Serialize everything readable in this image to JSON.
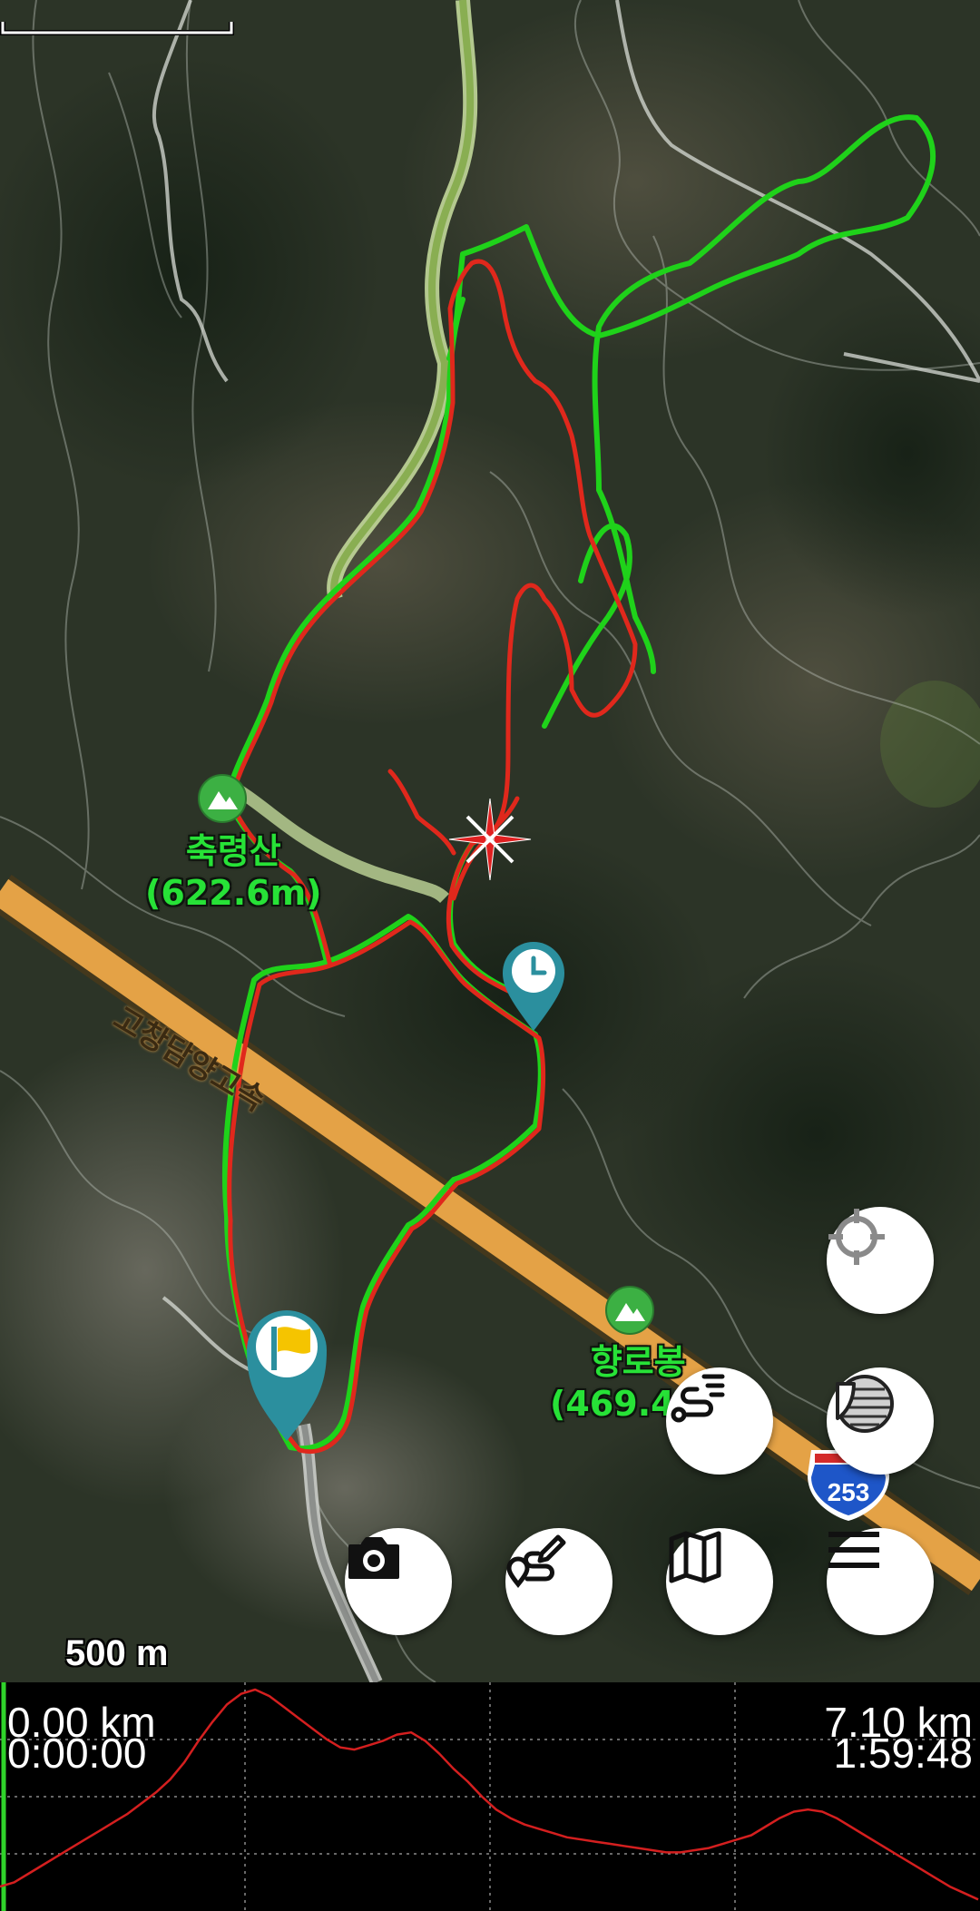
{
  "map": {
    "peaks": [
      {
        "name": "축령산",
        "elevation": "(622.6m)"
      },
      {
        "name": "향로봉",
        "elevation": "(469.4m)"
      }
    ],
    "road_name": "고창담양고속",
    "highway_shield": "253",
    "scale_label": "500 m",
    "track_colors": {
      "recorded": "#1fd21a",
      "planned": "#e0281c",
      "road": "#9dbb6c"
    }
  },
  "buttons": {
    "locate": "crosshair-icon",
    "layers": "layers-icon",
    "routes": "route-list-icon",
    "camera": "camera-icon",
    "draw_route": "draw-route-icon",
    "maps": "map-icon",
    "menu": "hamburger-icon"
  },
  "elevation_panel": {
    "start_distance": "0.00 km",
    "start_time": "0:00:00",
    "end_distance": "7.10 km",
    "end_time": "1:59:48",
    "profile": [
      0.08,
      0.1,
      0.14,
      0.18,
      0.22,
      0.26,
      0.3,
      0.34,
      0.38,
      0.42,
      0.47,
      0.52,
      0.58,
      0.66,
      0.76,
      0.85,
      0.93,
      0.98,
      1.0,
      0.97,
      0.92,
      0.87,
      0.82,
      0.77,
      0.73,
      0.72,
      0.74,
      0.76,
      0.79,
      0.8,
      0.76,
      0.7,
      0.63,
      0.57,
      0.5,
      0.44,
      0.4,
      0.37,
      0.35,
      0.33,
      0.31,
      0.3,
      0.29,
      0.28,
      0.27,
      0.26,
      0.25,
      0.24,
      0.24,
      0.25,
      0.26,
      0.28,
      0.3,
      0.32,
      0.36,
      0.4,
      0.43,
      0.44,
      0.43,
      0.4,
      0.36,
      0.32,
      0.28,
      0.24,
      0.2,
      0.16,
      0.12,
      0.08,
      0.05,
      0.02
    ]
  }
}
